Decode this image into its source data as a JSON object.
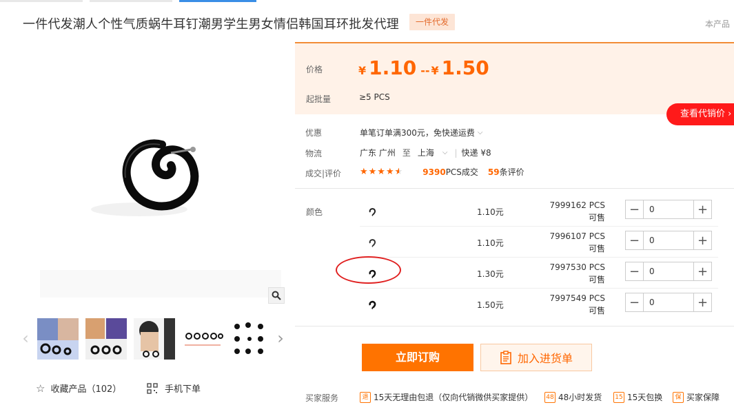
{
  "header": {
    "title": "一件代发潮人个性气质蜗牛耳钉潮男学生男女情侣韩国耳环批发代理",
    "badge": "一件代发",
    "corner_link": "本产品"
  },
  "gallery": {
    "thumb_count": 5,
    "favorite_label": "收藏产品（102）",
    "mobile_label": "手机下单"
  },
  "price": {
    "label": "价格",
    "currency": "¥",
    "min": "1.10",
    "separator": "--",
    "max": "1.50",
    "moq_label": "起批量",
    "moq_value": "≥5  PCS"
  },
  "distributor_button": "查看代销价 ›",
  "offer": {
    "discount_label": "优惠",
    "discount_text": "单笔订单满300元，免快递运费",
    "logistics_label": "物流",
    "from": "广东 广州",
    "to_word": "至",
    "to": "上海",
    "shipping": "快递 ¥8",
    "deals_label": "成交|评价",
    "rating_stars": 4.5,
    "sold_count": "9390",
    "sold_suffix": "PCS成交",
    "review_count": "59",
    "review_suffix": "条评价"
  },
  "sku": {
    "label": "颜色",
    "rows": [
      {
        "price": "1.10元",
        "stock": "7999162 PCS可售",
        "qty": "0"
      },
      {
        "price": "1.10元",
        "stock": "7996107 PCS可售",
        "qty": "0"
      },
      {
        "price": "1.30元",
        "stock": "7997530 PCS可售",
        "qty": "0"
      },
      {
        "price": "1.50元",
        "stock": "7997549 PCS可售",
        "qty": "0"
      }
    ]
  },
  "actions": {
    "buy_now": "立即订购",
    "add_cart": "加入进货单"
  },
  "services": {
    "label": "买家服务",
    "items": [
      {
        "icon": "退",
        "text": "15天无理由包退（仅向代销微供买家提供）"
      },
      {
        "icon": "48",
        "text": "48小时发货"
      },
      {
        "icon": "15",
        "text": "15天包换"
      },
      {
        "icon": "保",
        "text": "买家保障"
      }
    ]
  },
  "colors": {
    "accent": "#ff6600",
    "buy_button": "#ff7300",
    "price_bg": "#fff2e8",
    "distributor": "#ff1a1a"
  }
}
